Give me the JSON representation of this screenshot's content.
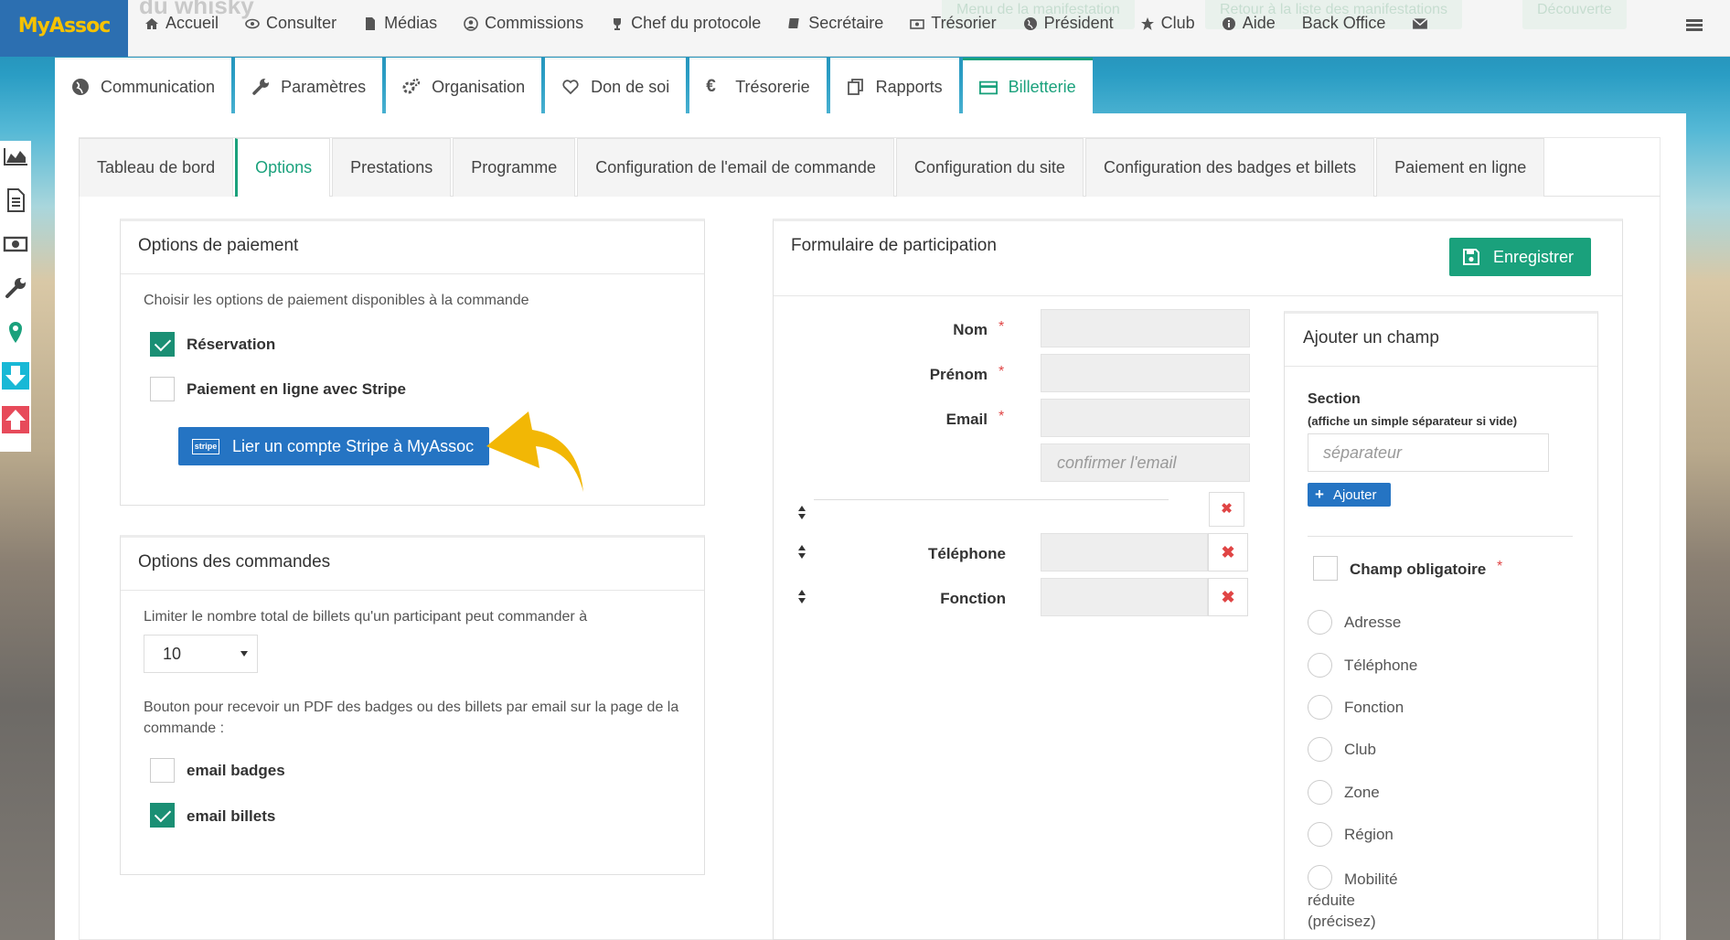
{
  "app": {
    "logo": "MyAssoc"
  },
  "ghost": {
    "title": "du whisky",
    "btn1": "Menu de la manifestation",
    "btn2": "Retour à la liste des manifestations",
    "btn3": "Découverte"
  },
  "topnav": [
    "Accueil",
    "Consulter",
    "Médias",
    "Commissions",
    "Chef du protocole",
    "Secrétaire",
    "Trésorier",
    "Président",
    "Club",
    "Aide",
    "Back Office"
  ],
  "mainnav": [
    "Communication",
    "Paramètres",
    "Organisation",
    "Don de soi",
    "Trésorerie",
    "Rapports",
    "Billetterie"
  ],
  "subnav": [
    "Tableau de bord",
    "Options",
    "Prestations",
    "Programme",
    "Configuration de l'email de commande",
    "Configuration du site",
    "Configuration des badges et billets",
    "Paiement en ligne"
  ],
  "payment": {
    "title": "Options de paiement",
    "desc": "Choisir les options de paiement disponibles à la commande",
    "opt1": "Réservation",
    "opt1_checked": true,
    "opt2": "Paiement en ligne avec Stripe",
    "opt2_checked": false,
    "stripe_badge": "stripe",
    "stripe_btn": "Lier un compte Stripe à MyAssoc"
  },
  "orders": {
    "title": "Options des commandes",
    "limit_label": "Limiter le nombre total de billets qu'un participant peut commander à",
    "limit_value": "10",
    "pdf_label": "Bouton pour recevoir un PDF des badges ou des billets par email sur la page de la commande :",
    "opt1": "email badges",
    "opt1_checked": false,
    "opt2": "email billets",
    "opt2_checked": true
  },
  "form": {
    "title": "Formulaire de participation",
    "save": "Enregistrer",
    "required_mark": "*",
    "fields": {
      "nom": "Nom",
      "prenom": "Prénom",
      "email": "Email",
      "email_confirm_ph": "confirmer l'email",
      "telephone": "Téléphone",
      "fonction": "Fonction"
    },
    "delete_glyph": "✖"
  },
  "addfield": {
    "title": "Ajouter un champ",
    "section_label": "Section",
    "section_hint": "(affiche un simple séparateur si vide)",
    "section_ph": "séparateur",
    "add_btn": "Ajouter",
    "required_label": "Champ obligatoire",
    "options": [
      "Adresse",
      "Téléphone",
      "Fonction",
      "Club",
      "Zone",
      "Région",
      "Mobilité réduite (précisez)"
    ]
  },
  "colors": {
    "accent": "#1aa17c",
    "brand": "#2c6fb1",
    "logo_text": "#f6c200",
    "stripe": "#2574c3",
    "arrow": "#f2b705",
    "required": "#e04545"
  }
}
